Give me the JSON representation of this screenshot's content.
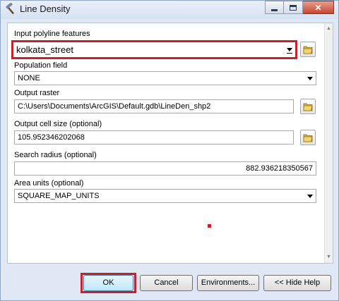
{
  "window": {
    "title": "Line Density"
  },
  "fields": {
    "input_polyline": {
      "label": "Input polyline features",
      "value": "kolkata_street"
    },
    "population_field": {
      "label": "Population field",
      "value": "NONE"
    },
    "output_raster": {
      "label": "Output raster",
      "value": "C:\\Users\\Documents\\ArcGIS\\Default.gdb\\LineDen_shp2"
    },
    "output_cell_size": {
      "label": "Output cell size (optional)",
      "value": "105.952346202068"
    },
    "search_radius": {
      "label": "Search radius (optional)",
      "value": "882.936218350567"
    },
    "area_units": {
      "label": "Area units (optional)",
      "value": "SQUARE_MAP_UNITS"
    }
  },
  "buttons": {
    "ok": "OK",
    "cancel": "Cancel",
    "environments": "Environments...",
    "hide_help": "<< Hide Help"
  },
  "colors": {
    "highlight": "#c4232b",
    "window_bg": "#dfe8f4"
  },
  "icons": {
    "title": "hammer-icon",
    "browse": "folder-icon"
  }
}
